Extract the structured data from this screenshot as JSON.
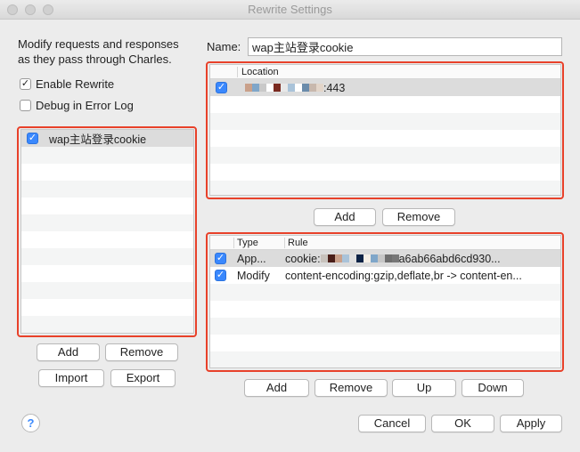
{
  "window": {
    "title": "Rewrite Settings"
  },
  "left": {
    "description_line1": "Modify requests and responses",
    "description_line2": "as they pass through Charles.",
    "enable_rewrite": {
      "label": "Enable Rewrite",
      "checked": true
    },
    "debug_log": {
      "label": "Debug in Error Log",
      "checked": false
    },
    "sets": [
      {
        "name": "wap主站登录cookie",
        "checked": true
      }
    ],
    "buttons": {
      "add": "Add",
      "remove": "Remove",
      "import": "Import",
      "export": "Export"
    }
  },
  "name_field": {
    "label": "Name:",
    "value": "wap主站登录cookie"
  },
  "locations": {
    "header": "Location",
    "rows": [
      {
        "checked": true,
        "suffix": ":443"
      }
    ],
    "buttons": {
      "add": "Add",
      "remove": "Remove"
    }
  },
  "rules": {
    "headers": {
      "type": "Type",
      "rule": "Rule"
    },
    "rows": [
      {
        "checked": true,
        "type": "App...",
        "rule_prefix": "cookie:",
        "rule_suffix": "a6ab66abd6cd930..."
      },
      {
        "checked": true,
        "type": "Modify",
        "rule_text": "content-encoding:gzip,deflate,br -> content-en..."
      }
    ],
    "buttons": {
      "add": "Add",
      "remove": "Remove",
      "up": "Up",
      "down": "Down"
    }
  },
  "footer": {
    "help": "?",
    "cancel": "Cancel",
    "ok": "OK",
    "apply": "Apply"
  },
  "colors": {
    "highlight": "#e8412a",
    "checkbox": "#3a88fd"
  }
}
